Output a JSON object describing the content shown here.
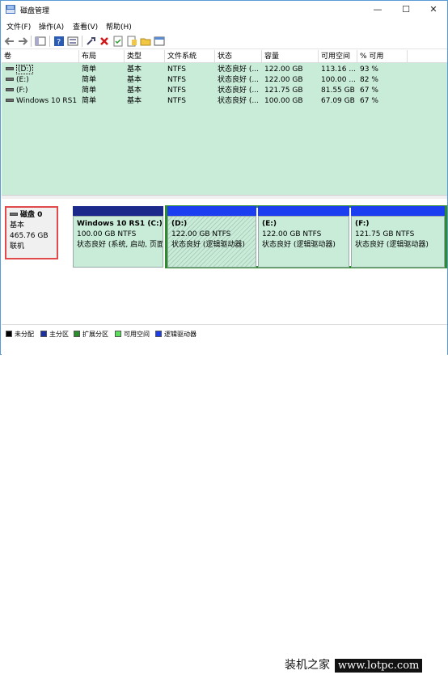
{
  "window": {
    "title": "磁盘管理"
  },
  "window_buttons": {
    "minimize": "—",
    "maximize": "☐",
    "close": "✕"
  },
  "menu": [
    "文件(F)",
    "操作(A)",
    "查看(V)",
    "帮助(H)"
  ],
  "toolbar_icons": [
    "back-arrow-icon",
    "forward-arrow-icon",
    "console-tree-icon",
    "help-icon",
    "properties-icon",
    "connect-icon",
    "delete-icon",
    "check-icon",
    "folder-icon",
    "folder-open-icon",
    "window-icon"
  ],
  "columns": [
    "卷",
    "布局",
    "类型",
    "文件系统",
    "状态",
    "容量",
    "可用空间",
    "% 可用"
  ],
  "volumes": [
    {
      "name": "(D:)",
      "layout": "简单",
      "type": "基本",
      "fs": "NTFS",
      "status": "状态良好 (...",
      "capacity": "122.00 GB",
      "free": "113.16 ...",
      "pct": "93 %"
    },
    {
      "name": "(E:)",
      "layout": "简单",
      "type": "基本",
      "fs": "NTFS",
      "status": "状态良好 (...",
      "capacity": "122.00 GB",
      "free": "100.00 ...",
      "pct": "82 %"
    },
    {
      "name": "(F:)",
      "layout": "简单",
      "type": "基本",
      "fs": "NTFS",
      "status": "状态良好 (...",
      "capacity": "121.75 GB",
      "free": "81.55 GB",
      "pct": "67 %"
    },
    {
      "name": "Windows 10 RS1 ...",
      "layout": "简单",
      "type": "基本",
      "fs": "NTFS",
      "status": "状态良好 (...",
      "capacity": "100.00 GB",
      "free": "67.09 GB",
      "pct": "67 %"
    }
  ],
  "disk": {
    "name": "磁盘 0",
    "type": "基本",
    "size": "465.76 GB",
    "status": "联机"
  },
  "partitions": [
    {
      "title": "Windows 10 RS1  (C:)",
      "size": "100.00 GB NTFS",
      "status": "状态良好 (系统, 启动, 页面"
    },
    {
      "title": "(D:)",
      "size": "122.00 GB NTFS",
      "status": "状态良好 (逻辑驱动器)"
    },
    {
      "title": "(E:)",
      "size": "122.00 GB NTFS",
      "status": "状态良好 (逻辑驱动器)"
    },
    {
      "title": "(F:)",
      "size": "121.75 GB NTFS",
      "status": "状态良好 (逻辑驱动器)"
    }
  ],
  "legend": [
    {
      "label": "未分配",
      "color": "#000000"
    },
    {
      "label": "主分区",
      "color": "#1b2fa6"
    },
    {
      "label": "扩展分区",
      "color": "#2e8b2e"
    },
    {
      "label": "可用空间",
      "color": "#58e058"
    },
    {
      "label": "逻辑驱动器",
      "color": "#1a3ef0"
    }
  ],
  "watermark": {
    "text1": "装机之家",
    "text2": "www.lotpc.com"
  },
  "colors": {
    "primary_bar": "#1b2a8a",
    "logical_bar": "#1a3ef0",
    "list_bg": "#c9ecd9",
    "extended_border": "#2e8b2e",
    "disk_label_border": "#e04a4a"
  }
}
